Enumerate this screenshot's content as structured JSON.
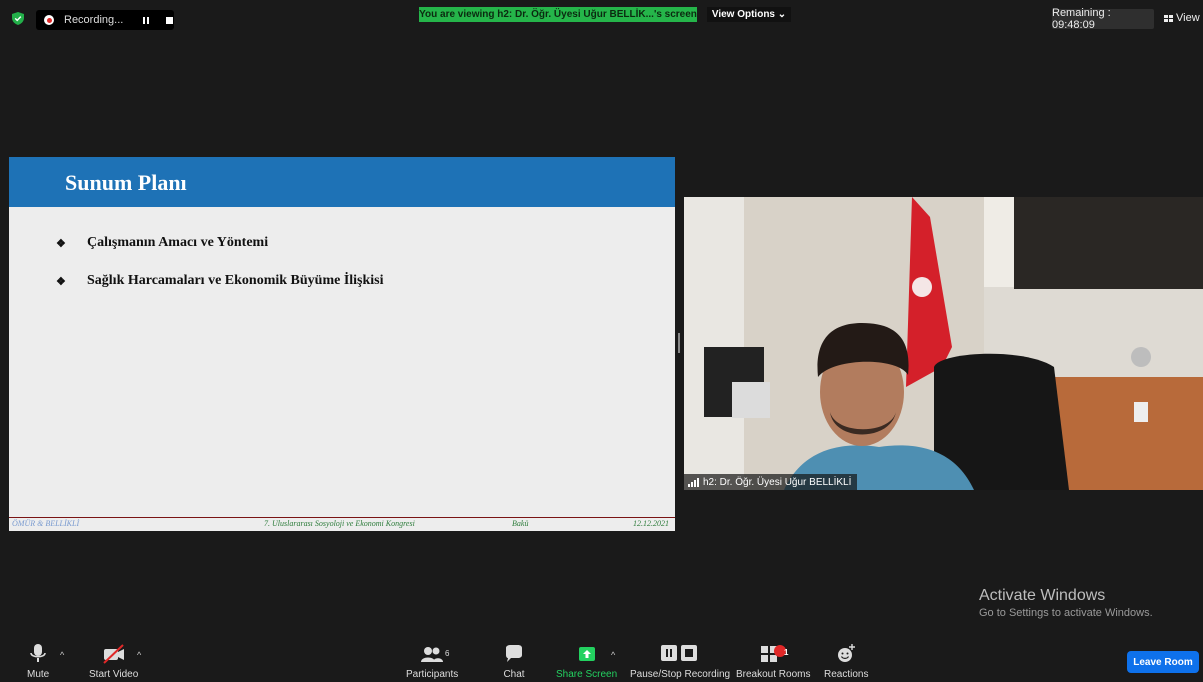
{
  "top_bar": {
    "recording_label": "Recording...",
    "viewing_banner": "You are viewing h2: Dr. Öğr. Üyesi Uğur BELLİK...'s screen",
    "view_options_label": "View Options ⌄",
    "remaining_label": "Remaining : 09:48:09",
    "view_label": "View"
  },
  "slide": {
    "title": "Sunum Planı",
    "bullet_symbol": "❖",
    "items": [
      "Çalışmanın Amacı ve Yöntemi",
      "Sağlık Harcamaları ve Ekonomik Büyüme İlişkisi"
    ],
    "footer": {
      "authors": "ÖMÜR & BELLİKLİ",
      "congress": "7. Uluslararası Sosyoloji ve Ekonomi Kongresi",
      "city": "Bakü",
      "date": "12.12.2021"
    }
  },
  "video": {
    "participant_name": "h2: Dr. Öğr. Üyesi Uğur BELLİKLİ"
  },
  "watermark": {
    "title": "Activate Windows",
    "subtitle": "Go to Settings to activate Windows."
  },
  "toolbar": {
    "mute_label": "Mute",
    "start_video_label": "Start Video",
    "participants_label": "Participants",
    "participants_count": "6",
    "chat_label": "Chat",
    "share_screen_label": "Share Screen",
    "recording_label": "Pause/Stop Recording",
    "breakout_label": "Breakout Rooms",
    "breakout_badge": "1",
    "reactions_label": "Reactions",
    "leave_label": "Leave Room",
    "caret": "^"
  },
  "colors": {
    "background": "#1a1a1a",
    "viewing_banner": "#25b54a",
    "slide_header": "#1e72b6",
    "leave_button": "#0e71eb",
    "share_green": "#23d160",
    "recording_red": "#e02828"
  }
}
